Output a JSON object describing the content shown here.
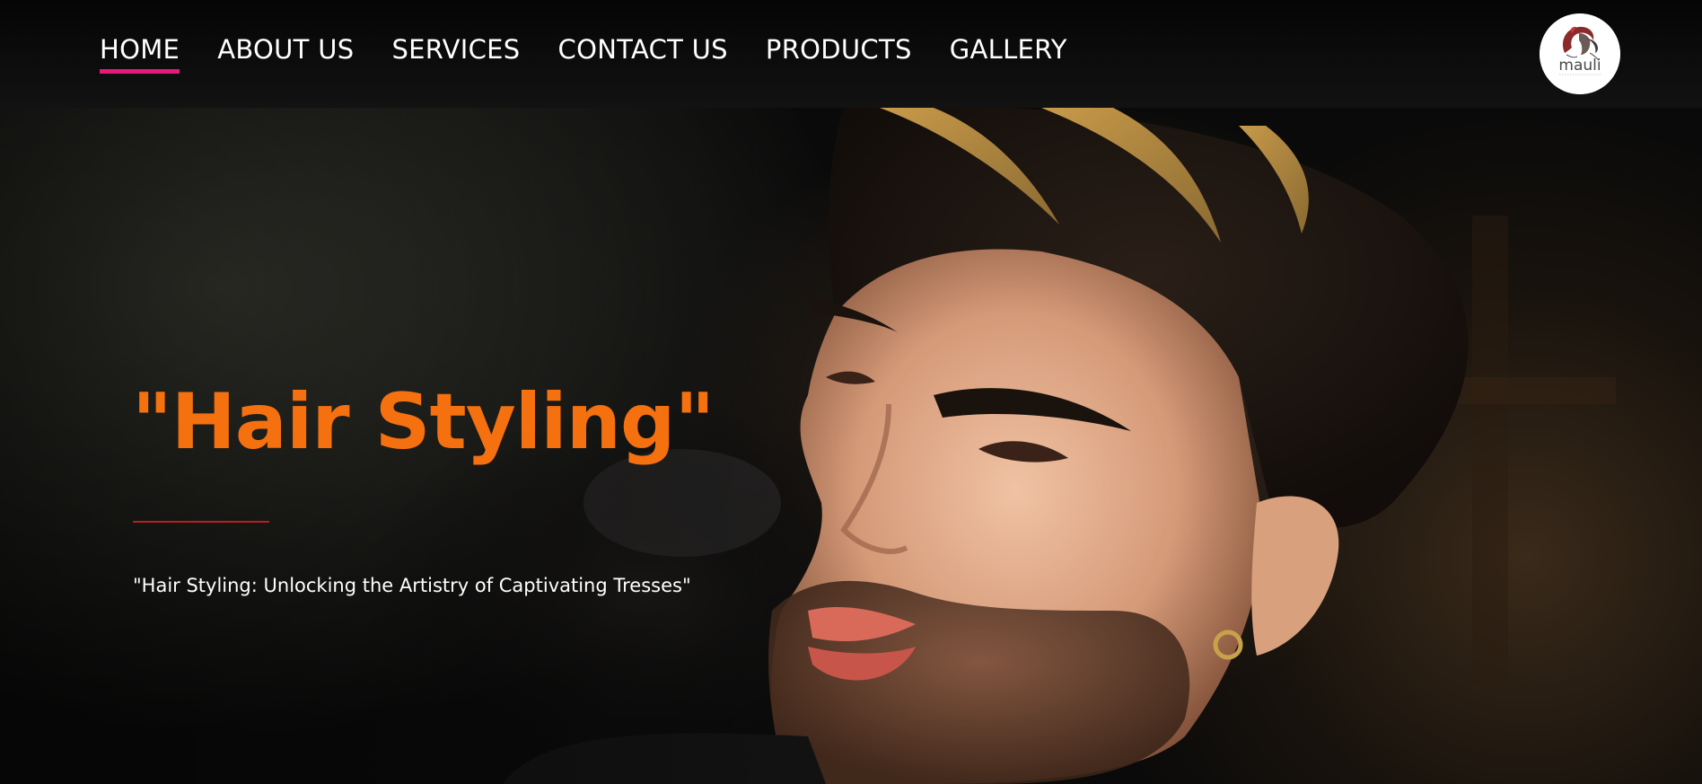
{
  "nav": {
    "items": [
      {
        "label": "HOME",
        "active": true
      },
      {
        "label": "ABOUT US",
        "active": false
      },
      {
        "label": "SERVICES",
        "active": false
      },
      {
        "label": "CONTACT US",
        "active": false
      },
      {
        "label": "PRODUCTS",
        "active": false
      },
      {
        "label": "GALLERY",
        "active": false
      }
    ],
    "active_color": "#e8187c"
  },
  "logo": {
    "text": "mauli",
    "icon": "salon-woman-face-logo"
  },
  "hero": {
    "title": "\"Hair Styling\"",
    "subtitle": "\"Hair Styling: Unlocking the Artistry of Captivating Tresses\"",
    "title_color": "#f5700f",
    "divider_color": "#b8201c",
    "image": "man-with-styled-hair-portrait"
  }
}
